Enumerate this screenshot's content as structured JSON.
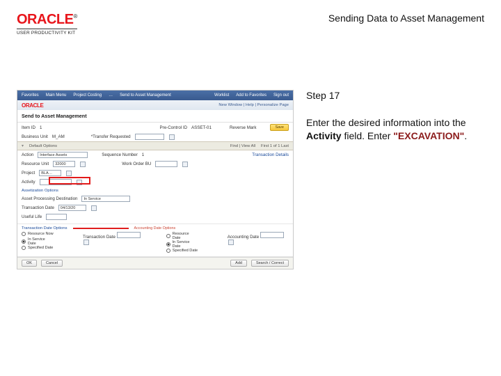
{
  "brand": {
    "word": "ORACLE",
    "tm": "®",
    "subline": "USER PRODUCTIVITY KIT"
  },
  "doc_title": "Sending Data to Asset Management",
  "step_label": "Step 17",
  "instruction": {
    "pre": "Enter the desired information into the ",
    "bold": "Activity",
    "mid": " field. Enter ",
    "literal": "\"EXCAVATION\"",
    "post": "."
  },
  "app": {
    "topbar": {
      "items": [
        "Favorites",
        "Main Menu",
        "Project Costing",
        "…",
        "Send to Asset Management"
      ],
      "right": [
        "Worklist",
        "Add to Favorites",
        "Sign out"
      ]
    },
    "brandbar": {
      "logo": "ORACLE",
      "right": "New Window | Help | Personalize Page"
    },
    "page_title": "Send to Asset Management",
    "header_fields": {
      "item_id": {
        "label": "Item ID",
        "value": "1"
      },
      "pre_control_id": {
        "label": "Pre-Control ID",
        "value": "ASSET-01"
      },
      "reverse_mark": {
        "label": "Reverse Mark",
        "value": ""
      },
      "bus_unit": {
        "label": "Business Unit",
        "value": "M_AM"
      },
      "date": {
        "label": "*Transfer Requested",
        "value": ""
      },
      "save_btn": "Save",
      "find_btn": "Find   |   View All",
      "pager": "First  1 of 1  Last"
    },
    "default_options_title": "Default Options",
    "detail_lines": {
      "action": {
        "label": "Action",
        "value": "Interface Assets",
        "options": [
          "Interface Assets"
        ]
      },
      "sequence": {
        "label": "Sequence Number",
        "value": "1"
      },
      "txn_details": "Transaction Details",
      "resource_unit": {
        "label": "Resource Unit",
        "value": "32000"
      },
      "work_order": {
        "label": "Work Order BU",
        "value": ""
      },
      "project": {
        "label": "Project",
        "value": "BLA…"
      },
      "activity": {
        "label": "Activity",
        "value": ""
      }
    },
    "asset_options": {
      "title": "Assetization Options",
      "asset_proc_dest": {
        "label": "Asset Processing Destination",
        "value": "In Service"
      },
      "transaction_date": {
        "label": "Transaction Date",
        "value": "04/13/20"
      },
      "useful_life": {
        "label": "Useful Life",
        "value": ""
      }
    },
    "txn_date_options": {
      "title": "Transaction Date Options",
      "subtitle": "Accounting Date Options",
      "left": {
        "resource_now": "Resource Now",
        "in_service_date": "In Service Date",
        "specified_date": "Specified Date"
      },
      "right": {
        "resource_date": "Resource Date",
        "in_service_date": "In Service Date",
        "specified_date": "Specified Date"
      },
      "checked_left": "in_service_date",
      "checked_right": "in_service_date",
      "tx_date": {
        "label": "Transaction Date",
        "value": ""
      },
      "acc_date": {
        "label": "Accounting Date",
        "value": ""
      }
    },
    "footer": {
      "ok": "OK",
      "cancel": "Cancel",
      "add": "Add",
      "search": "Search / Correct"
    }
  }
}
